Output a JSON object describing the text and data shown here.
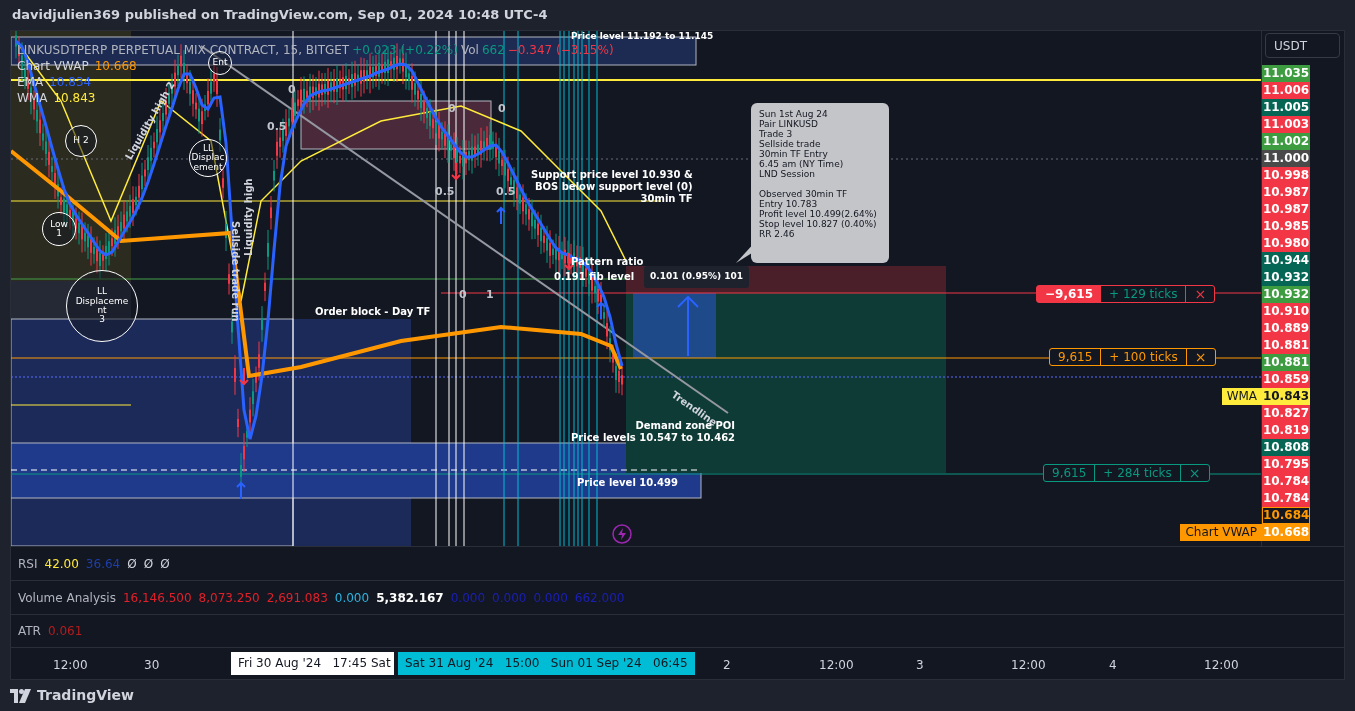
{
  "header": {
    "title": "davidjulien369 published on TradingView.com, Sep 01, 2024 10:48 UTC-4"
  },
  "legend": {
    "symbol": "LINKUSDTPERP PERPETUAL MIX CONTRACT, 15, BITGET",
    "change": "+0.023 (+0.22%)",
    "volume_label": "Vol",
    "volume": "662",
    "volume_change": "−0.347 (−3.15%)",
    "studies": [
      {
        "label": "Chart VWAP",
        "value": "10.668",
        "color": "#ff9800"
      },
      {
        "label": "EMA",
        "value": "10.834",
        "color": "#2962ff"
      },
      {
        "label": "WMA",
        "value": "10.843",
        "color": "#ffeb3b"
      }
    ]
  },
  "annotations": [
    {
      "kind": "circle",
      "lines": [
        "Ent"
      ]
    },
    {
      "kind": "label",
      "lines": [
        "Price level 11.192  to 11.145"
      ]
    },
    {
      "kind": "fib",
      "lines": [
        "0"
      ]
    },
    {
      "kind": "fib",
      "lines": [
        "0"
      ]
    },
    {
      "kind": "fib",
      "lines": [
        "0"
      ]
    },
    {
      "kind": "fib",
      "lines": [
        "0.5"
      ]
    },
    {
      "kind": "circle",
      "lines": [
        "H 2"
      ]
    },
    {
      "kind": "circle",
      "lines": [
        "LL",
        "Displac",
        "ement"
      ]
    },
    {
      "kind": "rotated",
      "lines": [
        "Liquidity high 2"
      ]
    },
    {
      "kind": "label",
      "lines": [
        "Support price level 10.930 &",
        "BOS below support level (0)",
        "30min TF"
      ]
    },
    {
      "kind": "fib",
      "lines": [
        "0.5"
      ]
    },
    {
      "kind": "fib",
      "lines": [
        "0.5"
      ]
    },
    {
      "kind": "circle",
      "lines": [
        "Low",
        "1"
      ]
    },
    {
      "kind": "label",
      "lines": [
        "Pattern ratio"
      ]
    },
    {
      "kind": "rotated",
      "lines": [
        "Liquidity high"
      ]
    },
    {
      "kind": "circle",
      "lines": [
        "LL",
        "Displaceme",
        "nt",
        "3"
      ]
    },
    {
      "kind": "label",
      "lines": [
        "0.191 fib level"
      ]
    },
    {
      "kind": "fib",
      "lines": [
        "0"
      ]
    },
    {
      "kind": "fib",
      "lines": [
        "1"
      ]
    },
    {
      "kind": "rotated",
      "lines": [
        "Sellside trade run"
      ]
    },
    {
      "kind": "label",
      "lines": [
        "Order block - Day TF"
      ]
    },
    {
      "kind": "rotated",
      "lines": [
        "Trendline"
      ]
    },
    {
      "kind": "label",
      "lines": [
        "Demand zone POI",
        "Price levels 10.547 to 10.462"
      ]
    },
    {
      "kind": "label",
      "lines": [
        "Price level 10.499"
      ]
    }
  ],
  "note": {
    "paragraphs": [
      [
        "Sun 1st Aug 24",
        "Pair LINKUSD",
        "Trade 3",
        "Sellside trade",
        "30min TF Entry",
        "6.45 am (NY Time)",
        "LND Session"
      ],
      [
        "Observed 30min TF",
        "Entry 10.783",
        "Profit level 10.499(2.64%)",
        "Stop level 10.827 (0.40%)",
        "RR 2.46"
      ]
    ]
  },
  "measure": {
    "text": "0.101 (0.95%) 101"
  },
  "positions": [
    {
      "kind": "filled",
      "quantity": "−9,615",
      "ticks": "+ 129 ticks",
      "close": "×",
      "color": "#f23645"
    },
    {
      "kind": "outline",
      "quantity": "9,615",
      "ticks": "+ 100 ticks",
      "close": "×",
      "color": "#ff9800"
    },
    {
      "kind": "outline",
      "quantity": "9,615",
      "ticks": "+ 284 ticks",
      "close": "×",
      "color": "#089981"
    }
  ],
  "price_axis": {
    "currency": "USDT",
    "labels": [
      {
        "text": "11.035",
        "color": "#3d9b40",
        "kind": "fill"
      },
      {
        "text": "11.006",
        "color": "#f23645",
        "kind": "fill"
      },
      {
        "text": "11.005",
        "color": "#056656",
        "kind": "fill"
      },
      {
        "text": "11.003",
        "color": "#f23645",
        "kind": "fill"
      },
      {
        "text": "11.002",
        "color": "#3d9b40",
        "kind": "fill"
      },
      {
        "text": "11.000",
        "color": "#4a4a4a",
        "kind": "fill"
      },
      {
        "text": "10.998",
        "color": "#f23645",
        "kind": "fill"
      },
      {
        "text": "10.987",
        "color": "#f23645",
        "kind": "fill"
      },
      {
        "text": "10.987",
        "color": "#f23645",
        "kind": "fill"
      },
      {
        "text": "10.985",
        "color": "#f23645",
        "kind": "fill"
      },
      {
        "text": "10.980",
        "color": "#f23645",
        "kind": "fill"
      },
      {
        "text": "10.944",
        "color": "#056656",
        "kind": "fill"
      },
      {
        "text": "10.932",
        "color": "#056656",
        "kind": "fill"
      },
      {
        "text": "10.932",
        "color": "#3d9b40",
        "kind": "fill"
      },
      {
        "text": "10.910",
        "color": "#f23645",
        "kind": "fill"
      },
      {
        "text": "10.889",
        "color": "#f23645",
        "kind": "fill"
      },
      {
        "text": "10.881",
        "color": "#f23645",
        "kind": "fill"
      },
      {
        "text": "10.881",
        "color": "#3d9b40",
        "kind": "fill"
      },
      {
        "text": "10.859",
        "color": "#f23645",
        "kind": "fill"
      },
      {
        "text": "10.843",
        "color": "#ffeb3b",
        "kind": "fill",
        "tag": "WMA"
      },
      {
        "text": "10.827",
        "color": "#f23645",
        "kind": "fill"
      },
      {
        "text": "10.819",
        "color": "#f23645",
        "kind": "fill"
      },
      {
        "text": "10.808",
        "color": "#056656",
        "kind": "fill"
      },
      {
        "text": "10.795",
        "color": "#f23645",
        "kind": "fill"
      },
      {
        "text": "10.784",
        "color": "#f23645",
        "kind": "fill"
      },
      {
        "text": "10.784",
        "color": "#f23645",
        "kind": "fill"
      },
      {
        "text": "10.684",
        "color": "#ff9800",
        "kind": "outline"
      },
      {
        "text": "10.668",
        "color": "#ff9800",
        "kind": "fill",
        "tag": "Chart VWAP"
      }
    ]
  },
  "indicators": [
    {
      "name": "RSI",
      "values": [
        {
          "text": "42.00",
          "color": "#ffeb3b"
        },
        {
          "text": "36.64",
          "color": "#1e3fa8"
        },
        {
          "text": "Ø",
          "color": "#d1d4dc"
        },
        {
          "text": "Ø",
          "color": "#d1d4dc"
        },
        {
          "text": "Ø",
          "color": "#d1d4dc"
        }
      ]
    },
    {
      "name": "Volume Analysis",
      "values": [
        {
          "text": "16,146.500",
          "color": "#e0202a"
        },
        {
          "text": "8,073.250",
          "color": "#e0202a"
        },
        {
          "text": "2,691.083",
          "color": "#e0202a"
        },
        {
          "text": "0.000",
          "color": "#2ab4e0"
        },
        {
          "text": "5,382.167",
          "color": "#ffffff"
        },
        {
          "text": "0.000",
          "color": "#1a1fb5"
        },
        {
          "text": "0.000",
          "color": "#1a1fb5"
        },
        {
          "text": "0.000",
          "color": "#1a1fb5"
        },
        {
          "text": "662.000",
          "color": "#1a1fb5"
        }
      ]
    },
    {
      "name": "ATR",
      "values": [
        {
          "text": "0.061",
          "color": "#b71c1c"
        }
      ]
    }
  ],
  "time_axis": [
    {
      "kind": "tick",
      "text": "12:00"
    },
    {
      "kind": "tick",
      "text": "30"
    },
    {
      "kind": "cursor",
      "text": "Fri 30 Aug '24   17:45"
    },
    {
      "kind": "cursor",
      "text": "Sat"
    },
    {
      "kind": "range",
      "text": "Sat 31 Aug '24   15:00   Sun 01 Sep '24   06:45"
    },
    {
      "kind": "tick",
      "text": "2"
    },
    {
      "kind": "tick",
      "text": "12:00"
    },
    {
      "kind": "tick",
      "text": "3"
    },
    {
      "kind": "tick",
      "text": "12:00"
    },
    {
      "kind": "tick",
      "text": "4"
    },
    {
      "kind": "tick",
      "text": "12:00"
    }
  ],
  "footer": {
    "brand": "TradingView"
  }
}
